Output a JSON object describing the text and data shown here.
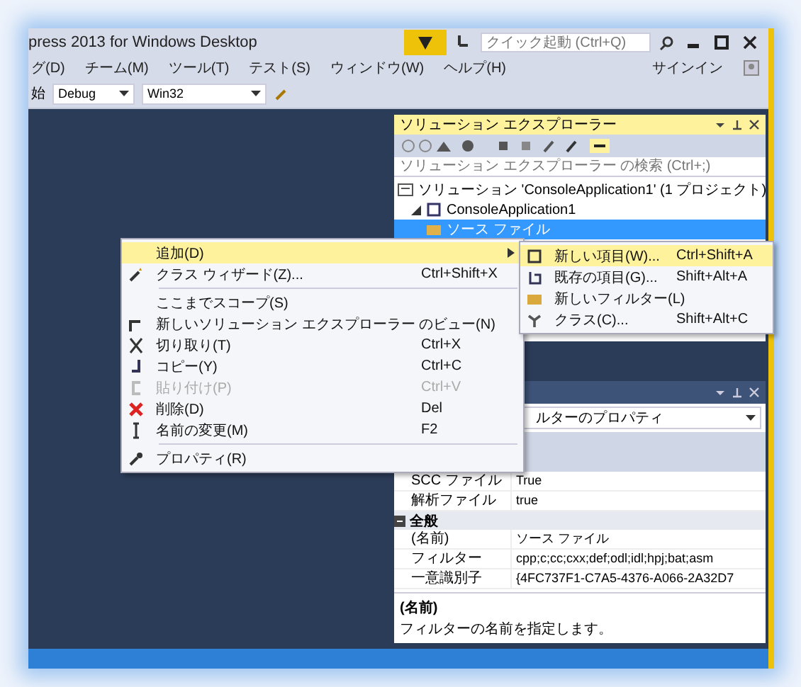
{
  "window": {
    "title": "press 2013 for Windows Desktop"
  },
  "menu": [
    {
      "label": "グ(D)"
    },
    {
      "label": "チーム(M)"
    },
    {
      "label": "ツール(T)"
    },
    {
      "label": "テスト(S)"
    },
    {
      "label": "ウィンドウ(W)"
    },
    {
      "label": "ヘルプ(H)"
    }
  ],
  "quick_launch": {
    "placeholder": "クイック起動 (Ctrl+Q)"
  },
  "sign_in": "サインイン",
  "toolbar": {
    "start": "始",
    "configuration": "Debug",
    "platform": "Win32"
  },
  "solution_explorer": {
    "title": "ソリューション エクスプローラー",
    "search": {
      "placeholder": "ソリューション エクスプローラー の検索 (Ctrl+;)"
    },
    "tree": [
      {
        "label": "ソリューション 'ConsoleApplication1' (1 プロジェクト)",
        "kind": "solution",
        "selected": false,
        "children": [
          {
            "label": "ConsoleApplication1",
            "kind": "project",
            "selected": false,
            "expanded": true,
            "children": [
              {
                "label": "ソース ファイル",
                "kind": "folder",
                "selected": true
              }
            ]
          }
        ]
      }
    ]
  },
  "context_menu": [
    {
      "kind": "item",
      "label": "追加(D)",
      "submenu": true,
      "selected": true,
      "disabled": false
    },
    {
      "kind": "item",
      "label": "クラス ウィザード(Z)...",
      "shortcut": "Ctrl+Shift+X",
      "submenu": false,
      "selected": false,
      "disabled": false
    },
    {
      "kind": "separator"
    },
    {
      "kind": "item",
      "label": "ここまでスコープ(S)",
      "submenu": false,
      "selected": false,
      "disabled": false
    },
    {
      "kind": "item",
      "label": "新しいソリューション エクスプローラー のビュー(N)",
      "submenu": false,
      "selected": false,
      "disabled": false
    },
    {
      "kind": "item",
      "label": "切り取り(T)",
      "shortcut": "Ctrl+X",
      "submenu": false,
      "selected": false,
      "disabled": false
    },
    {
      "kind": "item",
      "label": "コピー(Y)",
      "shortcut": "Ctrl+C",
      "submenu": false,
      "selected": false,
      "disabled": false
    },
    {
      "kind": "item",
      "label": "貼り付け(P)",
      "shortcut": "Ctrl+V",
      "submenu": false,
      "selected": false,
      "disabled": true
    },
    {
      "kind": "item",
      "label": "削除(D)",
      "shortcut": "Del",
      "submenu": false,
      "selected": false,
      "disabled": false
    },
    {
      "kind": "item",
      "label": "名前の変更(M)",
      "shortcut": "F2",
      "submenu": false,
      "selected": false,
      "disabled": false
    },
    {
      "kind": "separator"
    },
    {
      "kind": "item",
      "label": "プロパティ(R)",
      "submenu": false,
      "selected": false,
      "disabled": false
    }
  ],
  "submenu": [
    {
      "label": "新しい項目(W)...",
      "shortcut": "Ctrl+Shift+A",
      "selected": true
    },
    {
      "label": "既存の項目(G)...",
      "shortcut": "Shift+Alt+A",
      "selected": false
    },
    {
      "label": "新しいフィルター(L)",
      "selected": false
    },
    {
      "label": "クラス(C)...",
      "shortcut": "Shift+Alt+C",
      "selected": false
    }
  ],
  "properties": {
    "object": "ルターのプロパティ",
    "rows": [
      {
        "kind": "property",
        "name": "SCC ファイル",
        "value": "True"
      },
      {
        "kind": "property",
        "name": "解析ファイル",
        "value": "true"
      },
      {
        "kind": "category",
        "name": "全般",
        "expanded": true
      },
      {
        "kind": "property",
        "name": "(名前)",
        "value": "ソース ファイル"
      },
      {
        "kind": "property",
        "name": "フィルター",
        "value": "cpp;c;cc;cxx;def;odl;idl;hpj;bat;asm"
      },
      {
        "kind": "property",
        "name": "一意識別子",
        "value": "{4FC737F1-C7A5-4376-A066-2A32D7"
      }
    ],
    "description": {
      "title": "(名前)",
      "text": "フィルターの名前を指定します。"
    }
  }
}
